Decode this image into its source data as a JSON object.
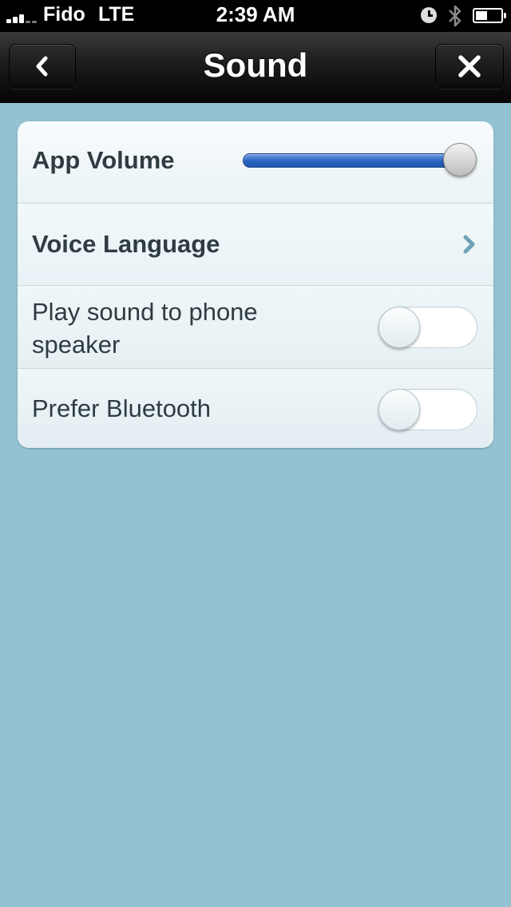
{
  "status_bar": {
    "carrier": "Fido",
    "network": "LTE",
    "time": "2:39 AM",
    "icons": [
      "signal-bars-icon",
      "alarm-icon",
      "bluetooth-icon",
      "battery-icon"
    ]
  },
  "nav": {
    "title": "Sound",
    "back_icon": "chevron-left-icon",
    "close_icon": "close-icon"
  },
  "settings": {
    "app_volume": {
      "label": "App Volume",
      "value": 1.0
    },
    "voice_language": {
      "label": "Voice Language",
      "icon": "chevron-right-icon"
    },
    "play_sound_phone_speaker": {
      "label_line1": "Play sound to phone",
      "label_line2": "speaker",
      "enabled": false
    },
    "prefer_bluetooth": {
      "label": "Prefer Bluetooth",
      "enabled": false
    }
  },
  "colors": {
    "background": "#93c3d3",
    "navbar": "#1c1c1c",
    "slider_fill": "#2a63c0",
    "card": "#eef6f9",
    "text": "#2f3c42",
    "chevron": "#6fa2b6"
  }
}
